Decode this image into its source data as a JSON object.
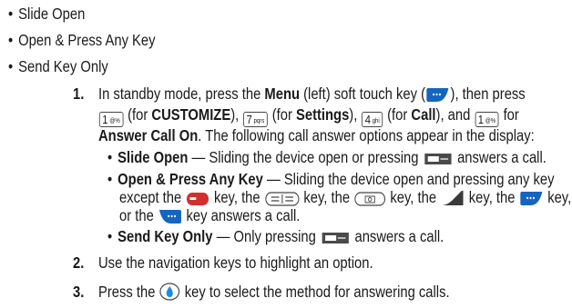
{
  "options": [
    "Slide Open",
    "Open & Press Any Key",
    "Send Key Only"
  ],
  "step1": {
    "number": "1.",
    "line1_a": "In standby mode, press the ",
    "line1_menu": "Menu",
    "line1_b": " (left) soft touch key (",
    "line1_c": "), then press",
    "key1_digit": "1",
    "key1_sub": "@%",
    "line2_a": " (for ",
    "line2_customize": "CUSTOMIZE",
    "line2_b": "), ",
    "key7_digit": "7",
    "key7_sub": "pqrs",
    "line2_c": " (for ",
    "line2_settings": "Settings",
    "line2_d": "), ",
    "key4_digit": "4",
    "key4_sub": "ghi",
    "line2_e": " (for ",
    "line2_call": "Call",
    "line2_f": "), and ",
    "line2_g": " for",
    "line3_answer": "Answer Call On",
    "line3_rest": ". The following call answer options appear in the display:"
  },
  "sub_options": {
    "slide_open_title": "Slide Open",
    "slide_open_text_a": " — Sliding the device open or pressing ",
    "slide_open_text_b": " answers a call.",
    "open_press_title": "Open & Press Any Key",
    "open_press_text_a": " — Sliding the device open and pressing any key",
    "open_press_line2_a": "except the ",
    "open_press_line2_b": " key, the ",
    "open_press_line2_c": " key, the ",
    "open_press_line2_d": " key, the ",
    "open_press_line2_e": " key, the ",
    "open_press_line2_f": " key,",
    "open_press_line3_a": "or the ",
    "open_press_line3_b": " key answers a call.",
    "send_only_title": "Send Key Only",
    "send_only_text_a": " — Only pressing ",
    "send_only_text_b": " answers a call."
  },
  "step2": {
    "number": "2.",
    "text": "Use the navigation keys to highlight an option."
  },
  "step3": {
    "number": "3.",
    "text_a": "Press the ",
    "text_b": " key to select the method for answering calls."
  },
  "colors": {
    "text": "#1a1a1a",
    "key_blue": "#1565c0",
    "key_red": "#d32f2f",
    "key_gray": "#5a5a5a",
    "ok_blue": "#1e88e5"
  }
}
